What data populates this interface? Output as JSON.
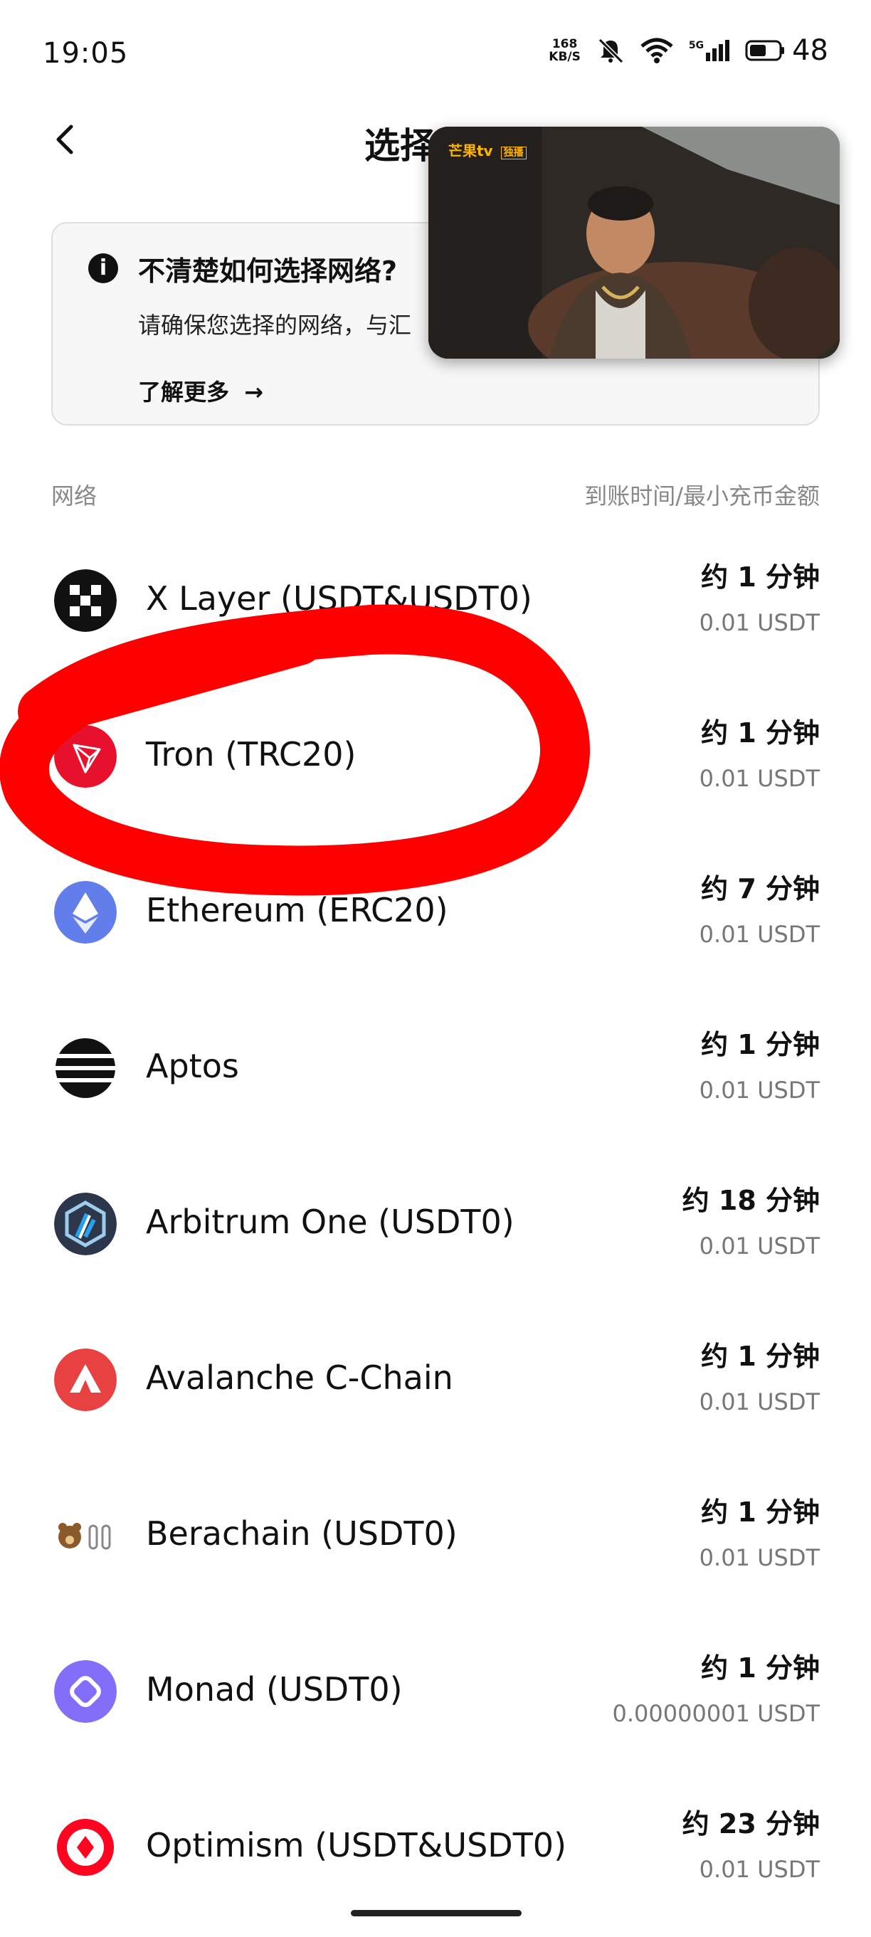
{
  "status_bar": {
    "time": "19:05",
    "net_speed_value": "168",
    "net_speed_unit": "KB/S",
    "signal_label": "5G",
    "battery": "48"
  },
  "header": {
    "title": "选择网络"
  },
  "video_overlay": {
    "logo_text": "芒果tv",
    "badge": "独播"
  },
  "info_card": {
    "title": "不清楚如何选择网络?",
    "desc": "请确保您选择的网络，与汇",
    "link": "了解更多"
  },
  "section": {
    "left": "网络",
    "right": "到账时间/最小充币金额"
  },
  "networks": [
    {
      "name": "X Layer (USDT&USDT0)",
      "time": "约 1 分钟",
      "min": "0.01 USDT",
      "icon": "x-layer-icon",
      "color": "#111111"
    },
    {
      "name": "Tron (TRC20)",
      "time": "约 1 分钟",
      "min": "0.01 USDT",
      "icon": "tron-icon",
      "color": "#e8112d"
    },
    {
      "name": "Ethereum (ERC20)",
      "time": "约 7 分钟",
      "min": "0.01 USDT",
      "icon": "ethereum-icon",
      "color": "#627eea"
    },
    {
      "name": "Aptos",
      "time": "约 1 分钟",
      "min": "0.01 USDT",
      "icon": "aptos-icon",
      "color": "#111111"
    },
    {
      "name": "Arbitrum One (USDT0)",
      "time": "约 18 分钟",
      "min": "0.01 USDT",
      "icon": "arbitrum-icon",
      "color": "#2d374b"
    },
    {
      "name": "Avalanche C-Chain",
      "time": "约 1 分钟",
      "min": "0.01 USDT",
      "icon": "avalanche-icon",
      "color": "#e84142"
    },
    {
      "name": "Berachain (USDT0)",
      "time": "约 1 分钟",
      "min": "0.01 USDT",
      "icon": "berachain-icon",
      "color": "#8b5a2b"
    },
    {
      "name": "Monad (USDT0)",
      "time": "约 1 分钟",
      "min": "0.00000001 USDT",
      "icon": "monad-icon",
      "color": "#836ef9"
    },
    {
      "name": "Optimism (USDT&USDT0)",
      "time": "约 23 分钟",
      "min": "0.01 USDT",
      "icon": "optimism-icon",
      "color": "#ff0420"
    }
  ]
}
